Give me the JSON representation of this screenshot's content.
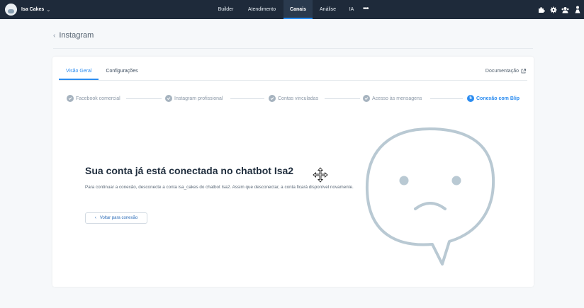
{
  "brand": {
    "name": "Isa Cakes"
  },
  "nav": {
    "items": [
      {
        "label": "Builder"
      },
      {
        "label": "Atendimento"
      },
      {
        "label": "Canais"
      },
      {
        "label": "Análise"
      },
      {
        "label": "IA"
      }
    ],
    "active": "Canais",
    "more": "•••"
  },
  "top_icons": [
    "puzzle-icon",
    "settings-gear-icon",
    "team-icon",
    "user-icon"
  ],
  "breadcrumb": {
    "back_icon": "chevron-left-icon",
    "title": "Instagram"
  },
  "tabs": [
    {
      "label": "Visão Geral",
      "active": true
    },
    {
      "label": "Configurações",
      "active": false
    }
  ],
  "documentation": {
    "label": "Documentação",
    "icon": "external-link-icon"
  },
  "steps": [
    {
      "label": "Facebook comercial",
      "state": "done"
    },
    {
      "label": "Instagram profissional",
      "state": "done"
    },
    {
      "label": "Contas vinculadas",
      "state": "done"
    },
    {
      "label": "Acesso às mensagens",
      "state": "done"
    },
    {
      "number": "5",
      "label": "Conexão com Blip",
      "state": "active"
    }
  ],
  "main": {
    "heading": "Sua conta já está conectada no chatbot Isa2",
    "description": "Para continuar a conexão, desconecte a conta isa_cakes do chatbot Isa2. Assim que desconectar, a conta ficará disponível novamente.",
    "back_button": "Voltar para conexão"
  },
  "colors": {
    "topbar": "#1e2a3a",
    "accent": "#2b8cf0",
    "illustration": "#b9c9d3"
  }
}
